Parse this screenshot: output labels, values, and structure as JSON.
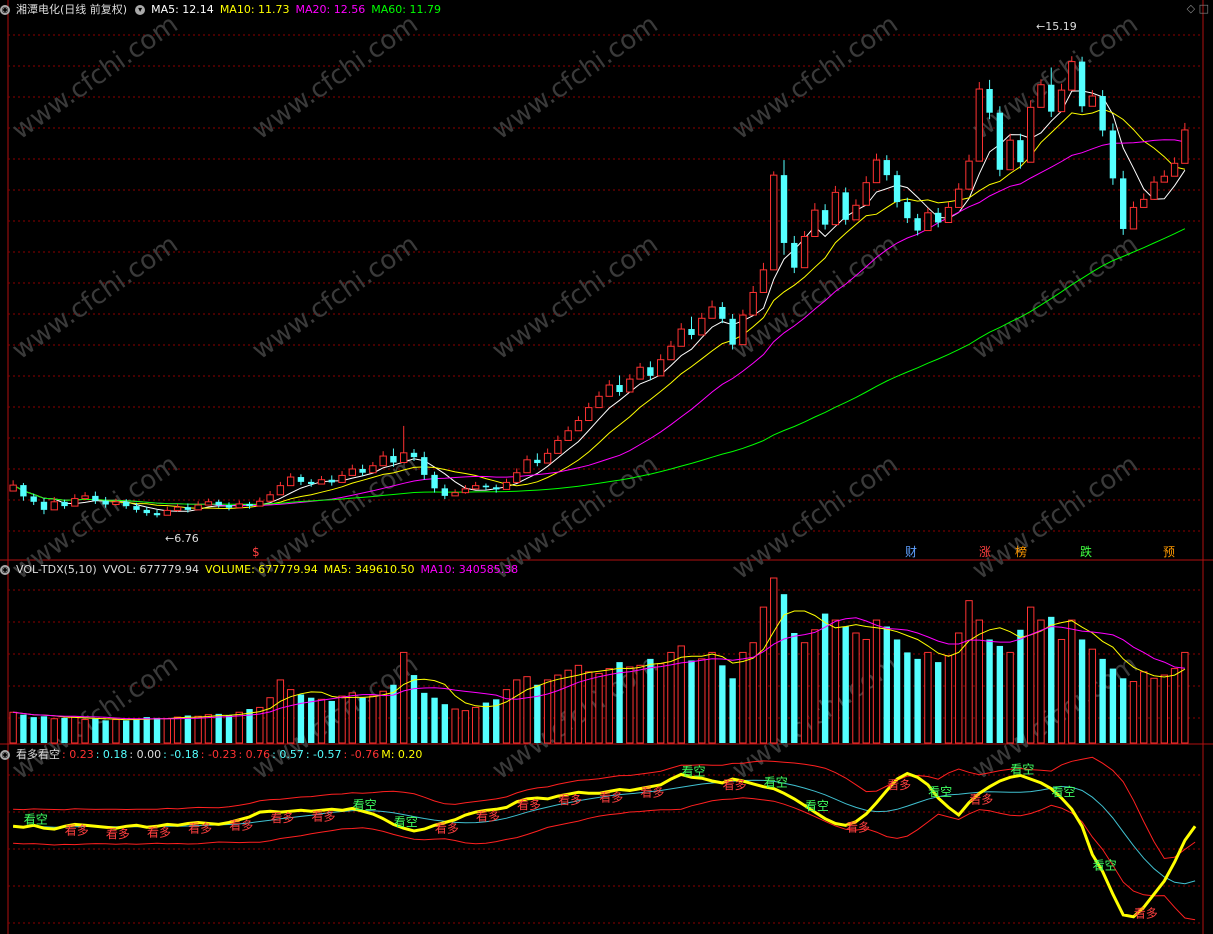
{
  "main_header": {
    "title": "湘潭电化(日线 前复权)",
    "ma5": "MA5: 12.14",
    "ma10": "MA10: 11.73",
    "ma20": "MA20: 12.56",
    "ma60": "MA60: 11.79"
  },
  "vol_header": {
    "title": "VOL-TDX(5,10)",
    "vvol": "VVOL: 677779.94",
    "volume": "VOLUME: 677779.94",
    "ma5": "MA5: 349610.50",
    "ma10": "MA10: 340585.38"
  },
  "ind_header": {
    "title": "看多看空",
    "v1": ": 0.23",
    "v2": ": 0.18",
    "v3": ": 0.00",
    "v4": ": -0.18",
    "v5": ": -0.23",
    "v6": ": 0.76",
    "v7": ": 0.57",
    "v8": ": -0.57",
    "v9": ": -0.76",
    "v10": "M: 0.20"
  },
  "watermark": "www.cfchi.com",
  "colors": {
    "up": "#ff3232",
    "down": "#54ffff",
    "ma5": "#ffffff",
    "ma10": "#ffff00",
    "ma20": "#ff00ff",
    "ma60": "#00ff00",
    "grid": "#8b0000",
    "panel_border": "#b01010",
    "indicator_main": "#ffff00"
  },
  "chart_data": {
    "type": "candlestick",
    "title": "湘潭电化(日线 前复权)",
    "annotations": {
      "high": "15.19",
      "low": "6.76"
    },
    "event_markers": [
      "$",
      "财",
      "涨",
      "榜",
      "跌",
      "预"
    ],
    "indicator_labels": {
      "bull": "看多",
      "bear": "看空"
    },
    "ylim": [
      6.3,
      16.0
    ],
    "candles": [
      [
        7.21,
        7.32,
        7.26,
        7.41
      ],
      [
        7.32,
        7.11,
        7.03,
        7.36
      ],
      [
        7.11,
        7.01,
        6.95,
        7.16
      ],
      [
        7.01,
        6.86,
        6.78,
        7.08
      ],
      [
        6.86,
        7.01,
        6.9,
        7.1
      ],
      [
        7.01,
        6.93,
        6.88,
        7.05
      ],
      [
        6.93,
        7.07,
        6.99,
        7.15
      ],
      [
        7.07,
        7.12,
        7.04,
        7.19
      ],
      [
        7.12,
        7.03,
        6.97,
        7.2
      ],
      [
        7.03,
        6.96,
        6.9,
        7.1
      ],
      [
        6.96,
        7.01,
        6.94,
        7.07
      ],
      [
        7.01,
        6.93,
        6.88,
        7.06
      ],
      [
        6.93,
        6.86,
        6.81,
        6.99
      ],
      [
        6.86,
        6.8,
        6.75,
        6.91
      ],
      [
        6.8,
        6.76,
        6.72,
        6.86
      ],
      [
        6.76,
        6.85,
        6.78,
        6.92
      ],
      [
        6.85,
        6.91,
        6.83,
        6.97
      ],
      [
        6.91,
        6.86,
        6.81,
        6.98
      ],
      [
        6.86,
        6.95,
        6.88,
        7.02
      ],
      [
        6.95,
        7.01,
        6.94,
        7.07
      ],
      [
        7.01,
        6.95,
        6.9,
        7.05
      ],
      [
        6.95,
        6.9,
        6.85,
        7.0
      ],
      [
        6.9,
        6.97,
        6.9,
        7.03
      ],
      [
        6.97,
        6.93,
        6.88,
        7.01
      ],
      [
        6.93,
        7.02,
        6.95,
        7.09
      ],
      [
        7.02,
        7.14,
        7.05,
        7.21
      ],
      [
        7.14,
        7.31,
        7.2,
        7.38
      ],
      [
        7.31,
        7.47,
        7.37,
        7.54
      ],
      [
        7.47,
        7.38,
        7.32,
        7.52
      ],
      [
        7.38,
        7.34,
        7.29,
        7.43
      ],
      [
        7.34,
        7.42,
        7.34,
        7.49
      ],
      [
        7.42,
        7.37,
        7.31,
        7.5
      ],
      [
        7.37,
        7.5,
        7.41,
        7.58
      ],
      [
        7.5,
        7.62,
        7.55,
        7.7
      ],
      [
        7.62,
        7.55,
        7.49,
        7.7
      ],
      [
        7.55,
        7.68,
        7.6,
        7.75
      ],
      [
        7.68,
        7.86,
        7.77,
        7.95
      ],
      [
        7.86,
        7.74,
        7.66,
        8.0
      ],
      [
        7.74,
        7.92,
        7.83,
        8.42
      ],
      [
        7.92,
        7.84,
        7.77,
        7.99
      ],
      [
        7.84,
        7.51,
        7.42,
        7.94
      ],
      [
        7.51,
        7.26,
        7.18,
        7.57
      ],
      [
        7.26,
        7.12,
        7.06,
        7.33
      ],
      [
        7.12,
        7.18,
        7.13,
        7.24
      ],
      [
        7.18,
        7.25,
        7.16,
        7.32
      ],
      [
        7.25,
        7.31,
        7.24,
        7.38
      ],
      [
        7.31,
        7.28,
        7.23,
        7.35
      ],
      [
        7.28,
        7.24,
        7.18,
        7.33
      ],
      [
        7.24,
        7.37,
        7.28,
        7.44
      ],
      [
        7.37,
        7.55,
        7.46,
        7.63
      ],
      [
        7.55,
        7.79,
        7.69,
        7.87
      ],
      [
        7.79,
        7.73,
        7.67,
        7.91
      ],
      [
        7.73,
        7.91,
        7.82,
        8.0
      ],
      [
        7.91,
        8.15,
        8.06,
        8.24
      ],
      [
        8.15,
        8.33,
        8.24,
        8.41
      ],
      [
        8.33,
        8.52,
        8.43,
        8.6
      ],
      [
        8.52,
        8.76,
        8.67,
        8.85
      ],
      [
        8.76,
        8.97,
        8.88,
        9.06
      ],
      [
        8.97,
        9.18,
        9.09,
        9.27
      ],
      [
        9.18,
        9.05,
        8.98,
        9.36
      ],
      [
        9.05,
        9.29,
        9.2,
        9.38
      ],
      [
        9.29,
        9.51,
        9.42,
        9.59
      ],
      [
        9.51,
        9.35,
        9.27,
        9.62
      ],
      [
        9.35,
        9.65,
        9.55,
        9.75
      ],
      [
        9.65,
        9.9,
        9.8,
        10.0
      ],
      [
        9.9,
        10.22,
        10.12,
        10.33
      ],
      [
        10.22,
        10.11,
        10.03,
        10.45
      ],
      [
        10.11,
        10.42,
        10.32,
        10.52
      ],
      [
        10.42,
        10.63,
        10.54,
        10.75
      ],
      [
        10.63,
        10.41,
        10.33,
        10.72
      ],
      [
        10.41,
        9.93,
        9.84,
        10.5
      ],
      [
        9.93,
        10.48,
        10.4,
        10.58
      ],
      [
        10.48,
        10.9,
        10.79,
        11.02
      ],
      [
        10.9,
        11.32,
        11.22,
        11.45
      ],
      [
        11.32,
        13.08,
        12.95,
        13.15
      ],
      [
        13.08,
        11.82,
        11.6,
        13.36
      ],
      [
        11.82,
        11.36,
        11.26,
        11.95
      ],
      [
        11.36,
        11.94,
        11.85,
        12.04
      ],
      [
        11.94,
        12.43,
        12.32,
        12.56
      ],
      [
        12.43,
        12.16,
        12.07,
        12.54
      ],
      [
        12.16,
        12.76,
        12.64,
        12.88
      ],
      [
        12.76,
        12.25,
        12.16,
        12.85
      ],
      [
        12.25,
        12.52,
        12.42,
        12.63
      ],
      [
        12.52,
        12.94,
        12.84,
        13.06
      ],
      [
        12.94,
        13.36,
        13.25,
        13.48
      ],
      [
        13.36,
        13.08,
        12.98,
        13.45
      ],
      [
        13.08,
        12.58,
        12.48,
        13.16
      ],
      [
        12.58,
        12.28,
        12.19,
        12.66
      ],
      [
        12.28,
        12.05,
        11.96,
        12.36
      ],
      [
        12.05,
        12.38,
        12.28,
        12.47
      ],
      [
        12.38,
        12.2,
        12.11,
        12.47
      ],
      [
        12.2,
        12.48,
        12.38,
        12.58
      ],
      [
        12.48,
        12.82,
        12.72,
        12.93
      ],
      [
        12.82,
        13.34,
        13.21,
        13.46
      ],
      [
        13.34,
        14.68,
        14.55,
        14.81
      ],
      [
        14.68,
        14.24,
        14.12,
        14.85
      ],
      [
        14.24,
        13.18,
        13.06,
        14.36
      ],
      [
        13.18,
        13.73,
        13.62,
        13.85
      ],
      [
        13.73,
        13.32,
        13.2,
        13.85
      ],
      [
        13.32,
        14.34,
        14.22,
        14.47
      ],
      [
        14.34,
        14.76,
        14.65,
        14.86
      ],
      [
        14.76,
        14.26,
        14.16,
        15.08
      ],
      [
        14.26,
        14.66,
        14.54,
        14.78
      ],
      [
        14.66,
        15.19,
        15.05,
        15.29
      ],
      [
        15.19,
        14.36,
        14.25,
        15.28
      ],
      [
        14.36,
        14.55,
        14.44,
        14.66
      ],
      [
        14.55,
        13.91,
        13.8,
        14.66
      ],
      [
        13.91,
        13.02,
        12.9,
        14.04
      ],
      [
        13.02,
        12.08,
        11.97,
        13.16
      ],
      [
        12.08,
        12.48,
        12.36,
        12.59
      ],
      [
        12.48,
        12.63,
        12.51,
        12.74
      ],
      [
        12.63,
        12.95,
        12.84,
        13.06
      ],
      [
        12.95,
        13.06,
        12.95,
        13.17
      ],
      [
        13.06,
        13.3,
        13.18,
        13.41
      ],
      [
        13.3,
        13.92,
        13.81,
        14.05
      ]
    ],
    "volume": [
      190,
      175,
      160,
      165,
      150,
      155,
      160,
      145,
      150,
      140,
      145,
      140,
      150,
      160,
      155,
      150,
      160,
      170,
      165,
      175,
      180,
      170,
      190,
      210,
      220,
      280,
      390,
      330,
      300,
      280,
      270,
      260,
      290,
      310,
      280,
      290,
      320,
      360,
      560,
      420,
      310,
      280,
      240,
      210,
      200,
      220,
      250,
      270,
      330,
      390,
      410,
      360,
      390,
      420,
      450,
      480,
      440,
      430,
      460,
      500,
      470,
      480,
      520,
      490,
      560,
      600,
      510,
      520,
      560,
      480,
      400,
      560,
      620,
      840,
      1020,
      920,
      680,
      620,
      700,
      800,
      760,
      720,
      680,
      640,
      760,
      720,
      640,
      560,
      520,
      560,
      500,
      540,
      680,
      880,
      760,
      640,
      600,
      560,
      700,
      840,
      760,
      780,
      640,
      760,
      640,
      580,
      520,
      460,
      400,
      380,
      440,
      400,
      420,
      460,
      560
    ],
    "indicator": [
      0.2,
      0.19,
      0.21,
      0.18,
      0.17,
      0.2,
      0.22,
      0.21,
      0.2,
      0.19,
      0.18,
      0.2,
      0.21,
      0.19,
      0.2,
      0.22,
      0.21,
      0.23,
      0.24,
      0.23,
      0.22,
      0.24,
      0.27,
      0.3,
      0.35,
      0.36,
      0.35,
      0.36,
      0.37,
      0.36,
      0.37,
      0.38,
      0.37,
      0.39,
      0.36,
      0.33,
      0.28,
      0.22,
      0.18,
      0.15,
      0.17,
      0.21,
      0.24,
      0.27,
      0.32,
      0.35,
      0.37,
      0.38,
      0.4,
      0.46,
      0.49,
      0.5,
      0.49,
      0.52,
      0.54,
      0.56,
      0.55,
      0.55,
      0.57,
      0.59,
      0.58,
      0.6,
      0.62,
      0.64,
      0.7,
      0.75,
      0.72,
      0.71,
      0.68,
      0.66,
      0.7,
      0.68,
      0.65,
      0.62,
      0.6,
      0.55,
      0.49,
      0.42,
      0.35,
      0.28,
      0.23,
      0.21,
      0.25,
      0.33,
      0.45,
      0.58,
      0.7,
      0.76,
      0.72,
      0.64,
      0.5,
      0.4,
      0.32,
      0.45,
      0.55,
      0.62,
      0.68,
      0.72,
      0.74,
      0.7,
      0.66,
      0.6,
      0.5,
      0.38,
      0.2,
      -0.1,
      -0.28,
      -0.52,
      -0.74,
      -0.76,
      -0.66,
      -0.52,
      -0.38,
      -0.18,
      0.05,
      0.2
    ]
  }
}
